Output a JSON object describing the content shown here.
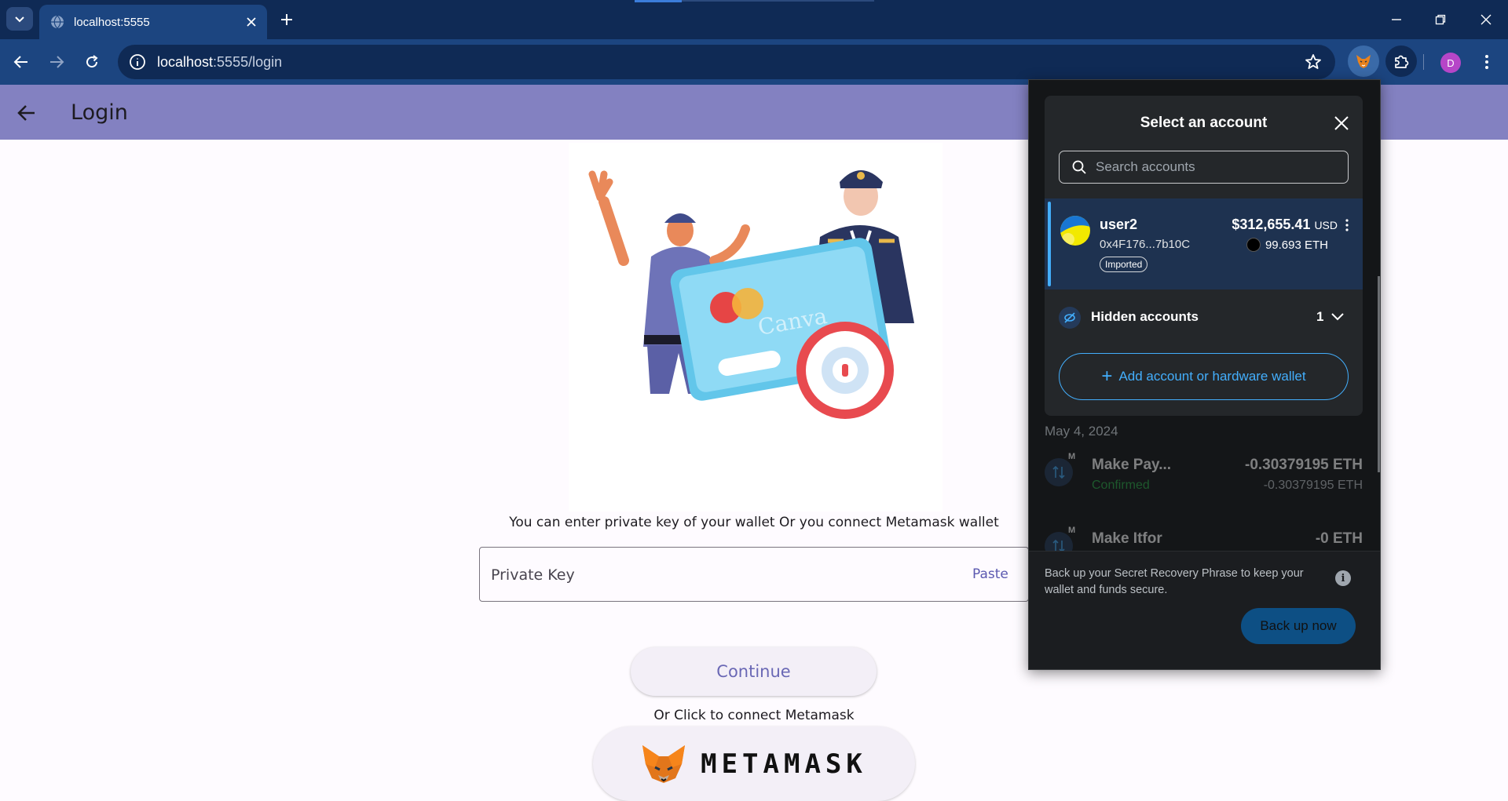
{
  "browser": {
    "tab_title": "localhost:5555",
    "url_host": "localhost",
    "url_path": ":5555/login",
    "profile_initial": "D"
  },
  "page": {
    "title": "Login",
    "instructions": "You can enter private key of your wallet Or you connect Metamask wallet",
    "private_key_label": "Private Key",
    "paste_label": "Paste",
    "continue_label": "Continue",
    "or_click_text": "Or Click to connect Metamask",
    "metamask_button_text": "METAMASK",
    "illustration_watermark": "Canva"
  },
  "metamask": {
    "title": "Select an account",
    "search_placeholder": "Search accounts",
    "account": {
      "name": "user2",
      "address": "0x4F176...7b10C",
      "badge": "Imported",
      "fiat_value": "$312,655.41",
      "fiat_currency": "USD",
      "eth_value": "99.693 ETH"
    },
    "hidden_accounts_label": "Hidden accounts",
    "hidden_accounts_count": "1",
    "add_account_label": "Add account or hardware wallet",
    "date_label": "May 4, 2024",
    "transactions": [
      {
        "title": "Make Pay...",
        "status": "Confirmed",
        "amount": "-0.30379195 ETH",
        "amount_secondary": "-0.30379195 ETH",
        "badge": "M"
      },
      {
        "title": "Make Itfor",
        "status": "",
        "amount": "-0 ETH",
        "amount_secondary": "",
        "badge": "M"
      }
    ],
    "backup_text": "Back up your Secret Recovery Phrase to keep your wallet and funds secure.",
    "backup_button": "Back up now"
  },
  "colors": {
    "appbar": "#8381c1",
    "chrome_dark": "#0f2a55",
    "chrome_mid": "#1c4580",
    "mm_accent": "#43aefc"
  }
}
